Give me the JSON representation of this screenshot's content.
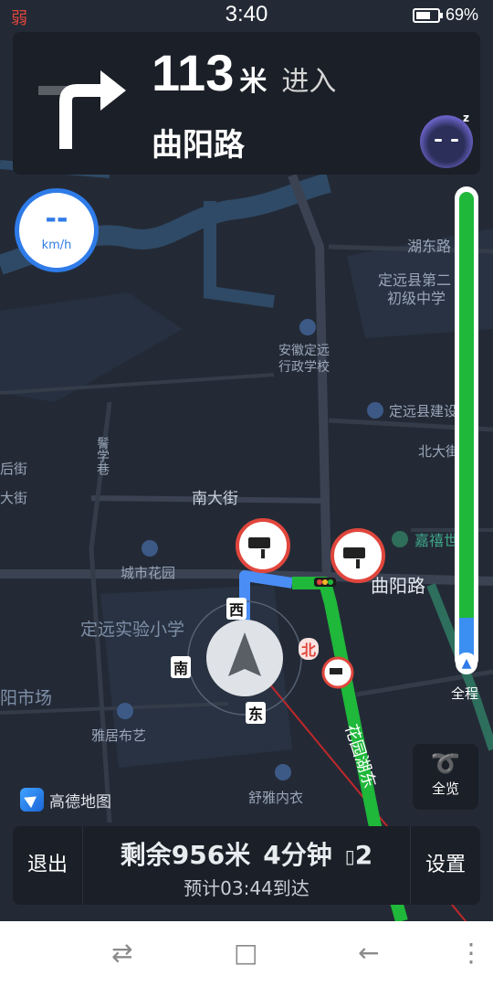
{
  "status_bar": {
    "signal": "弱",
    "time": "3:40",
    "battery": "69%"
  },
  "guidance": {
    "distance": "113",
    "unit": "米",
    "action": "进入",
    "road": "曲阳路"
  },
  "speed": {
    "value": "--",
    "unit": "km/h"
  },
  "route_progress": {
    "completed_fraction": 0.1
  },
  "map_labels": {
    "hudong_road": "湖东路",
    "middle_school": "定远县第二\n初级中学",
    "admin_school": "安徽定远\n行政学校",
    "construction": "定远县建设",
    "north_street": "北大街",
    "south_street": "南大街",
    "ge_street": "鬌学巷",
    "city_garden": "城市花园",
    "experimental_school": "定远实验小学",
    "market": "阳市场",
    "yaju": "雅居布艺",
    "shuya": "舒雅内衣",
    "jiaxi": "嘉禧世广",
    "quyang_road": "曲阳路",
    "huayuan_road": "花园湖东",
    "left_edge_1": "后街",
    "left_edge_2": "大街"
  },
  "compass": {
    "west": "西",
    "south": "南",
    "east": "东",
    "north": "北"
  },
  "overview_button": {
    "label": "全览"
  },
  "full_route_label": "全程",
  "logo": {
    "text": "高德地图"
  },
  "trip": {
    "exit_label": "退出",
    "remaining_distance": "剩余956米",
    "remaining_time": "4分钟",
    "lights": "2",
    "eta": "预计03:44到达",
    "settings_label": "设置"
  },
  "colors": {
    "route_green": "#1fb83a",
    "route_blue": "#3b8ef2",
    "accent": "#2f7be8",
    "camera_red": "#e0463c"
  },
  "system_nav": {
    "switch": "⇄",
    "home": "□",
    "back": "←",
    "menu": "⋮"
  }
}
